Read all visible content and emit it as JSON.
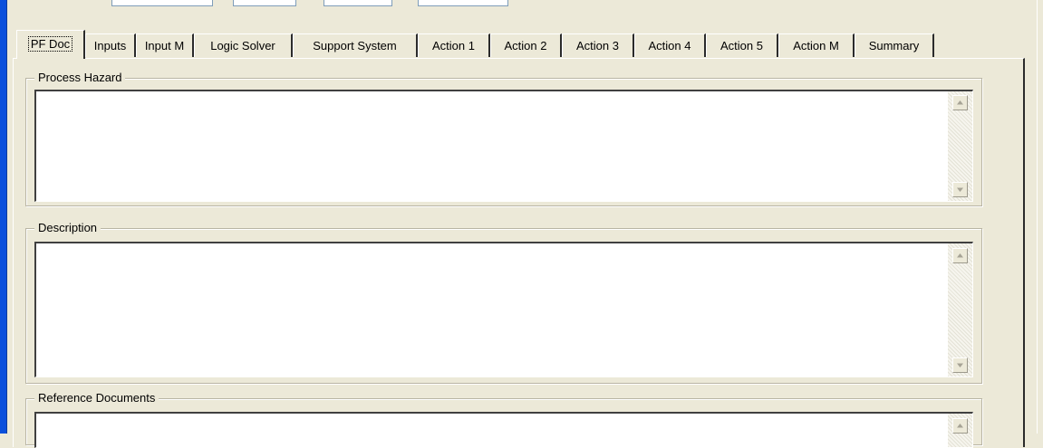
{
  "tabs": [
    {
      "label": "PF Doc",
      "active": true
    },
    {
      "label": "Inputs"
    },
    {
      "label": "Input M"
    },
    {
      "label": "Logic Solver"
    },
    {
      "label": "Support System"
    },
    {
      "label": "Action 1"
    },
    {
      "label": "Action 2"
    },
    {
      "label": "Action 3"
    },
    {
      "label": "Action 4"
    },
    {
      "label": "Action 5"
    },
    {
      "label": "Action M"
    },
    {
      "label": "Summary"
    }
  ],
  "groups": {
    "process_hazard": {
      "label": "Process Hazard",
      "value": ""
    },
    "description": {
      "label": "Description",
      "value": ""
    },
    "reference_documents": {
      "label": "Reference Documents",
      "value": ""
    }
  },
  "icons": {
    "scroll_up": "scroll-up-arrow-icon",
    "scroll_down": "scroll-down-arrow-icon"
  },
  "colors": {
    "window_face": "#ece9d8",
    "window_frame": "#0a50dc",
    "memo_background": "#ffffff"
  }
}
